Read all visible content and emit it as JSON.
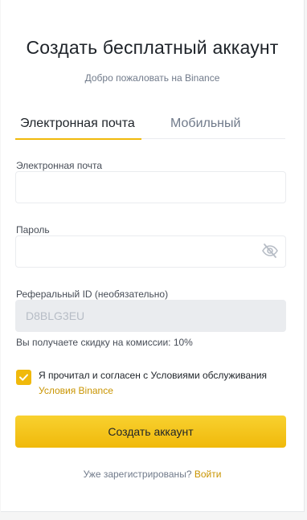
{
  "header": {
    "title": "Создать бесплатный аккаунт",
    "subtitle": "Добро пожаловать на Binance"
  },
  "tabs": [
    {
      "label": "Электронная почта",
      "active": true
    },
    {
      "label": "Мобильный",
      "active": false
    }
  ],
  "form": {
    "email": {
      "label": "Электронная почта",
      "value": "",
      "placeholder": ""
    },
    "password": {
      "label": "Пароль",
      "value": "",
      "placeholder": ""
    },
    "referral": {
      "label": "Реферальный ID (необязательно)",
      "value": "D8BLG3EU"
    },
    "referral_hint": "Вы получаете скидку на комиссии: 10%",
    "terms": {
      "checked": true,
      "text": "Я прочитал и согласен с Условиями обслуживания",
      "link": "Условия Binance"
    },
    "submit_label": "Создать аккаунт"
  },
  "footer": {
    "text": "Уже зарегистрированы?",
    "link": "Войти"
  },
  "colors": {
    "accent": "#f0b90b",
    "link": "#c99400",
    "text": "#1e2329",
    "muted": "#707a8a"
  },
  "icons": {
    "password_toggle": "eye-slash-icon",
    "checkbox": "checkmark-icon"
  }
}
